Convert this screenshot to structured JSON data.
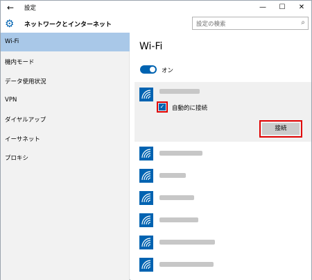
{
  "window": {
    "title": "設定",
    "back_icon": "←",
    "minimize_icon": "—",
    "maximize_icon": "☐",
    "close_icon": "✕"
  },
  "header": {
    "gear_icon": "⚙",
    "title": "ネットワークとインターネット",
    "search_placeholder": "設定の検索",
    "search_icon": "⌕"
  },
  "sidebar": {
    "items": [
      {
        "label": "Wi-Fi",
        "active": true
      },
      {
        "label": "機内モード"
      },
      {
        "label": "データ使用状況"
      },
      {
        "label": "VPN"
      },
      {
        "label": "ダイヤルアップ"
      },
      {
        "label": "イーサネット"
      },
      {
        "label": "プロキシ"
      }
    ]
  },
  "main": {
    "title": "Wi-Fi",
    "toggle_label": "オン",
    "auto_connect_label": "自動的に接続",
    "check_mark": "✓",
    "connect_label": "接続"
  },
  "colors": {
    "accent": "#0063b1",
    "highlight_border": "#e00000",
    "sidebar_active": "#a9c8e8",
    "sidebar_bg": "#f2f2f2"
  }
}
